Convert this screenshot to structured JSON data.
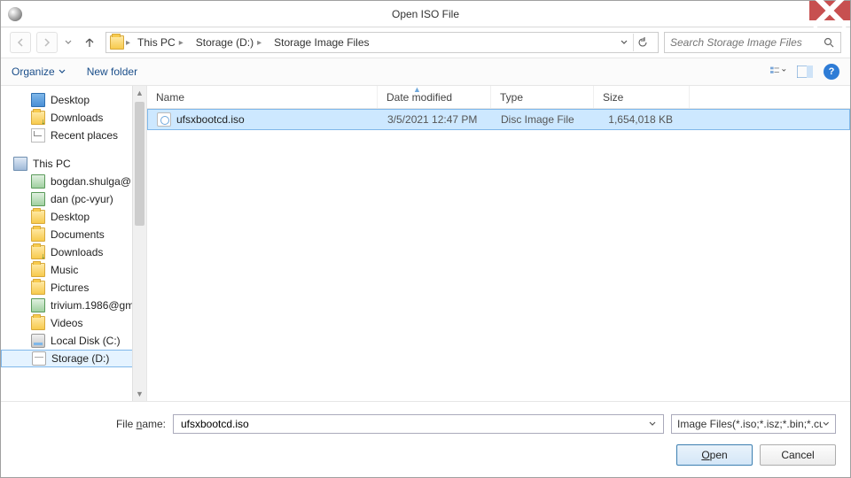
{
  "window": {
    "title": "Open ISO File"
  },
  "nav": {
    "breadcrumbs": [
      "This PC",
      "Storage (D:)",
      "Storage Image Files"
    ],
    "search_placeholder": "Search Storage Image Files"
  },
  "toolbar": {
    "organize": "Organize",
    "new_folder": "New folder"
  },
  "tree": {
    "group1": [
      {
        "label": "Desktop",
        "icon": "desktop"
      },
      {
        "label": "Downloads",
        "icon": "folder-dl"
      },
      {
        "label": "Recent places",
        "icon": "recent"
      }
    ],
    "thispc_label": "This PC",
    "group2": [
      {
        "label": "bogdan.shulga@",
        "icon": "net"
      },
      {
        "label": "dan (pc-vyur)",
        "icon": "net"
      },
      {
        "label": "Desktop",
        "icon": "folder"
      },
      {
        "label": "Documents",
        "icon": "folder"
      },
      {
        "label": "Downloads",
        "icon": "folder-dl"
      },
      {
        "label": "Music",
        "icon": "folder"
      },
      {
        "label": "Pictures",
        "icon": "folder"
      },
      {
        "label": "trivium.1986@gm",
        "icon": "net"
      },
      {
        "label": "Videos",
        "icon": "folder"
      },
      {
        "label": "Local Disk (C:)",
        "icon": "disk"
      },
      {
        "label": "Storage (D:)",
        "icon": "drive",
        "selected": true
      }
    ]
  },
  "columns": {
    "name": "Name",
    "date": "Date modified",
    "type": "Type",
    "size": "Size"
  },
  "files": [
    {
      "name": "ufsxbootcd.iso",
      "date": "3/5/2021 12:47 PM",
      "type": "Disc Image File",
      "size": "1,654,018 KB",
      "selected": true
    }
  ],
  "footer": {
    "filename_label_pre": "File ",
    "filename_label_u": "n",
    "filename_label_post": "ame:",
    "filename_value": "ufsxbootcd.iso",
    "filter": "Image Files(*.iso;*.isz;*.bin;*.cue",
    "open_u": "O",
    "open_rest": "pen",
    "cancel": "Cancel"
  }
}
